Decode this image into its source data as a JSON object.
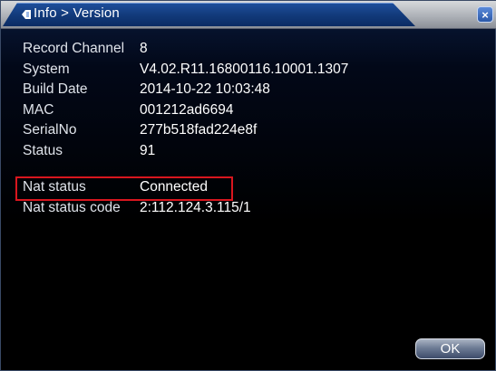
{
  "window": {
    "title": "Info > Version",
    "close_label": "×"
  },
  "info_rows": [
    {
      "label": "Record Channel",
      "value": "8"
    },
    {
      "label": "System",
      "value": "V4.02.R11.16800116.10001.1307"
    },
    {
      "label": "Build Date",
      "value": "2014-10-22 10:03:48"
    },
    {
      "label": "MAC",
      "value": "001212ad6694"
    },
    {
      "label": "SerialNo",
      "value": "277b518fad224e8f"
    },
    {
      "label": "Status",
      "value": "91"
    }
  ],
  "nat_rows": [
    {
      "label": "Nat status",
      "value": "Connected"
    },
    {
      "label": "Nat status code",
      "value": "2:112.124.3.115/1"
    }
  ],
  "buttons": {
    "ok_label": "OK"
  },
  "colors": {
    "highlight": "#d9161e",
    "title_tab": "#123a7a",
    "background": "#000000"
  },
  "icons": {
    "title_icon": "info-icon",
    "close_icon": "close-icon"
  }
}
